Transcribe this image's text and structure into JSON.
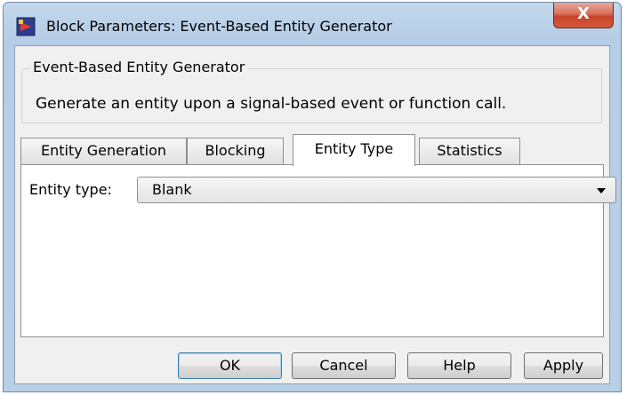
{
  "window": {
    "title": "Block Parameters: Event-Based Entity Generator",
    "close_label": "X",
    "accent_color": "#c6442a"
  },
  "description": {
    "group_title": "Event-Based Entity Generator",
    "text": "Generate an entity upon a signal-based event or function call."
  },
  "tabs": [
    {
      "label": "Entity Generation",
      "active": false
    },
    {
      "label": "Blocking",
      "active": false
    },
    {
      "label": "Entity Type",
      "active": true
    },
    {
      "label": "Statistics",
      "active": false
    }
  ],
  "entity_type": {
    "label": "Entity type:",
    "value": "Blank"
  },
  "buttons": {
    "ok": "OK",
    "cancel": "Cancel",
    "help": "Help",
    "apply": "Apply"
  }
}
